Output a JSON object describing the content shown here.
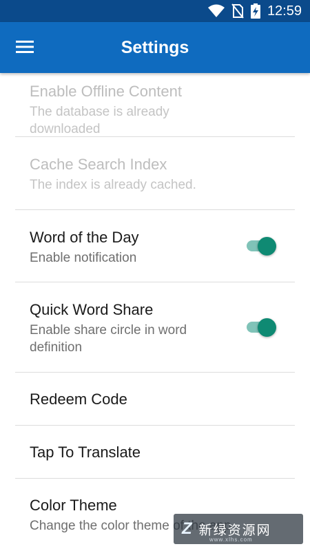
{
  "status_bar": {
    "time": "12:59"
  },
  "app_bar": {
    "title": "Settings"
  },
  "settings": [
    {
      "title": "Enable Offline Content",
      "subtitle": "The database is already downloaded",
      "enabled": false
    },
    {
      "title": "Cache Search Index",
      "subtitle": "The index is already cached.",
      "enabled": false
    },
    {
      "title": "Word of the Day",
      "subtitle": "Enable notification",
      "toggle_on": true
    },
    {
      "title": "Quick Word Share",
      "subtitle": "Enable share circle in word definition",
      "toggle_on": true
    },
    {
      "title": "Redeem Code"
    },
    {
      "title": "Tap To Translate"
    },
    {
      "title": "Color Theme",
      "subtitle": "Change the color theme of the app"
    }
  ],
  "watermark": {
    "text": "新绿资源网",
    "url": "www.xlhs.com"
  },
  "colors": {
    "app_bar": "#0f6bbf",
    "status_bar": "#0b4a8b",
    "toggle_thumb": "#0f8a73",
    "toggle_track": "#80c3b8"
  }
}
